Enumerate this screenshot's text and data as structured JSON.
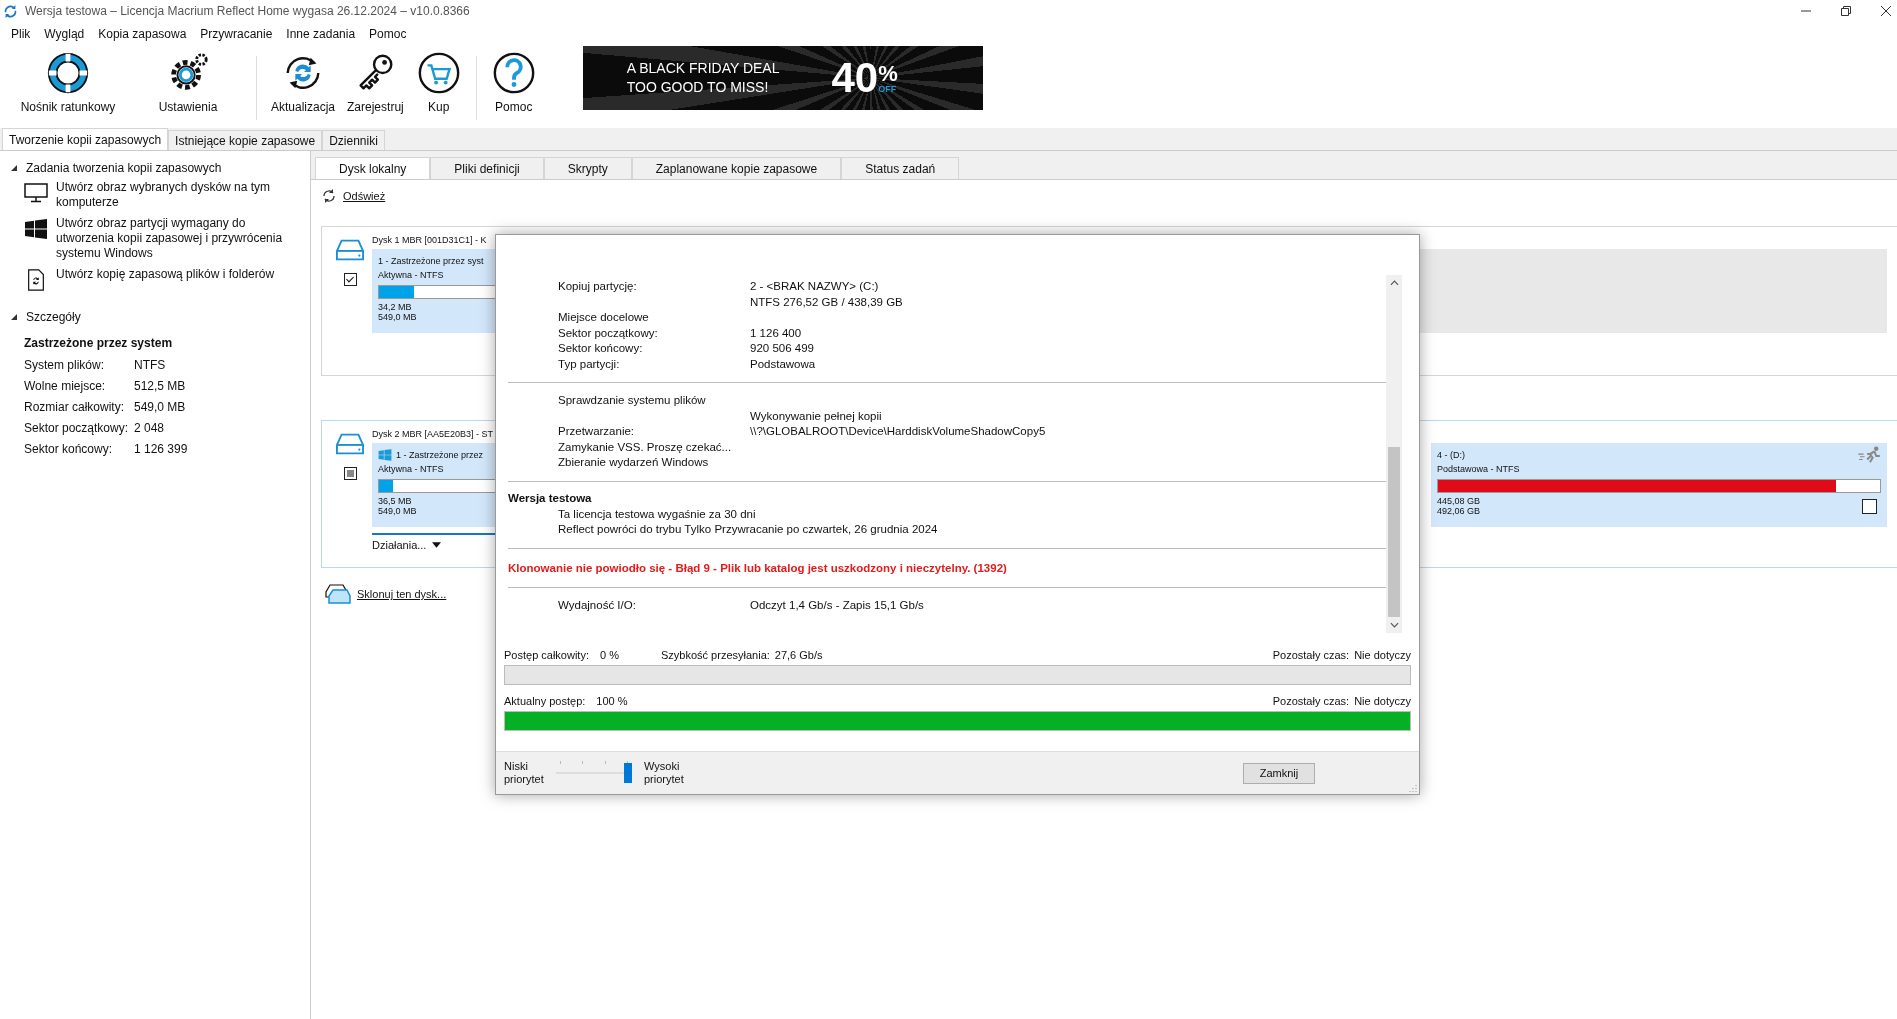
{
  "window": {
    "title": "Wersja testowa – Licencja Macrium Reflect Home wygasa 26.12.2024 – v10.0.8366"
  },
  "menu": [
    "Plik",
    "Wygląd",
    "Kopia zapasowa",
    "Przywracanie",
    "Inne zadania",
    "Pomoc"
  ],
  "toolbar": [
    {
      "label": "Nośnik ratunkowy",
      "separator_after": false
    },
    {
      "label": "Ustawienia",
      "separator_after": true
    },
    {
      "label": "Aktualizacja",
      "separator_after": false
    },
    {
      "label": "Zarejestruj",
      "separator_after": false
    },
    {
      "label": "Kup",
      "separator_after": true
    },
    {
      "label": "Pomoc",
      "separator_after": false
    }
  ],
  "banner": {
    "line1": "A BLACK FRIDAY DEAL",
    "line2": "TOO GOOD TO MISS!",
    "percent": "40",
    "percent_sign": "%",
    "off": "OFF"
  },
  "tabs": [
    {
      "label": "Tworzenie kopii zapasowych",
      "selected": true
    },
    {
      "label": "Istniejące kopie zapasowe",
      "selected": false
    },
    {
      "label": "Dzienniki",
      "selected": false
    }
  ],
  "sidebar": {
    "tasks": {
      "title": "Zadania tworzenia kopii zapasowych",
      "expanded": true,
      "items": [
        "Utwórz obraz wybranych dysków na tym komputerze",
        "Utwórz obraz partycji wymagany do utworzenia kopii zapasowej i przywrócenia systemu Windows",
        "Utwórz kopię zapasową plików i folderów"
      ]
    },
    "details": {
      "title": "Szczegóły",
      "expanded": true,
      "heading": "Zastrzeżone przez system",
      "rows": [
        {
          "label": "System plików:",
          "value": "NTFS"
        },
        {
          "label": "Wolne miejsce:",
          "value": "512,5 MB"
        },
        {
          "label": "Rozmiar całkowity:",
          "value": "549,0 MB"
        },
        {
          "label": "Sektor początkowy:",
          "value": "2 048"
        },
        {
          "label": "Sektor końcowy:",
          "value": "1 126 399"
        }
      ]
    }
  },
  "content_tabs": [
    {
      "label": "Dysk lokalny",
      "selected": true
    },
    {
      "label": "Pliki definicji",
      "selected": false
    },
    {
      "label": "Skrypty",
      "selected": false
    },
    {
      "label": "Zaplanowane kopie zapasowe",
      "selected": false
    },
    {
      "label": "Status zadań",
      "selected": false
    }
  ],
  "refresh_link": "Odśwież",
  "disks": [
    {
      "label": "Dysk 1 MBR [001D31C1] - K",
      "checked": true,
      "indeterminate": false,
      "partitions": [
        {
          "kind": "partition",
          "name": "1 - Zastrzeżone przez syst",
          "type": "Aktywna - NTFS",
          "level": 0.3,
          "used": "34,2 MB",
          "total": "549,0 MB",
          "color": "#00a2e8",
          "system_logo": false
        },
        {
          "kind": "unallocated"
        }
      ]
    },
    {
      "label": "Dysk 2 MBR [AA5E20B3] - ST",
      "checked": false,
      "indeterminate": true,
      "actions": "Działania...",
      "partitions": [
        {
          "kind": "partition",
          "name": "1 - Zastrzeżone przez",
          "type": "Aktywna - NTFS",
          "level": 0.12,
          "used": "36,5 MB",
          "total": "549,0 MB",
          "color": "#00a2e8",
          "system_logo": true
        },
        {
          "kind": "partition",
          "name": "4 -  (D:)",
          "type": "Podstawowa - NTFS",
          "level": 0.9,
          "used": "445,08 GB",
          "total": "492,06 GB",
          "color": "#e00b18",
          "system_logo": false,
          "checked": false
        }
      ]
    }
  ],
  "clone_link": "Sklonuj ten dysk...",
  "dialog": {
    "sections": [
      {
        "kind": "details",
        "rows": [
          {
            "label": "Kopiuj partycję:",
            "values": [
              "2 - <BRAK NAZWY> (C:)",
              "NTFS 276,52 GB / 438,39 GB"
            ]
          },
          {
            "label": "Miejsce docelowe"
          },
          {
            "label": "Sektor początkowy:",
            "values": [
              "1 126 400"
            ]
          },
          {
            "label": "Sektor końcowy:",
            "values": [
              "920 506 499"
            ]
          },
          {
            "label": "Typ partycji:",
            "values": [
              "Podstawowa"
            ]
          }
        ]
      },
      {
        "kind": "details",
        "rows": [
          {
            "label": "Sprawdzanie systemu plików"
          },
          {
            "values": [
              "Wykonywanie pełnej kopii"
            ]
          },
          {
            "label": "Przetwarzanie:",
            "values": [
              "\\\\?\\GLOBALROOT\\Device\\HarddiskVolumeShadowCopy5"
            ]
          },
          {
            "label": "Zamykanie VSS. Proszę czekać..."
          },
          {
            "label": "Zbieranie wydarzeń Windows"
          }
        ]
      },
      {
        "kind": "details",
        "heading": "Wersja testowa",
        "rows": [
          {
            "label": "Ta licencja testowa wygaśnie za 30 dni"
          },
          {
            "label": "Reflect powróci do trybu Tylko Przywracanie po czwartek, 26 grudnia 2024"
          }
        ]
      },
      {
        "kind": "error",
        "text": "Klonowanie nie powiodło się - Błąd 9 - Plik lub katalog jest uszkodzony i nieczytelny. (1392)"
      },
      {
        "kind": "details",
        "rows": [
          {
            "label": "Wydajność I/O:",
            "values": [
              "Odczyt 1,4 Gb/s - Zapis 15,1 Gb/s"
            ]
          }
        ]
      }
    ],
    "overall": {
      "label": "Postęp całkowity:",
      "value": "0 %",
      "speed_label": "Szybkość przesyłania:",
      "speed": "27,6 Gb/s",
      "remaining_label": "Pozostały czas:",
      "remaining": "Nie dotyczy",
      "level": 0
    },
    "current": {
      "label": "Aktualny postęp:",
      "value": "100 %",
      "remaining_label": "Pozostały czas:",
      "remaining": "Nie dotyczy",
      "level": 1
    },
    "priority": {
      "low": "Niski priorytet",
      "high": "Wysoki priorytet",
      "level": 1
    },
    "close_button": "Zamknij"
  }
}
